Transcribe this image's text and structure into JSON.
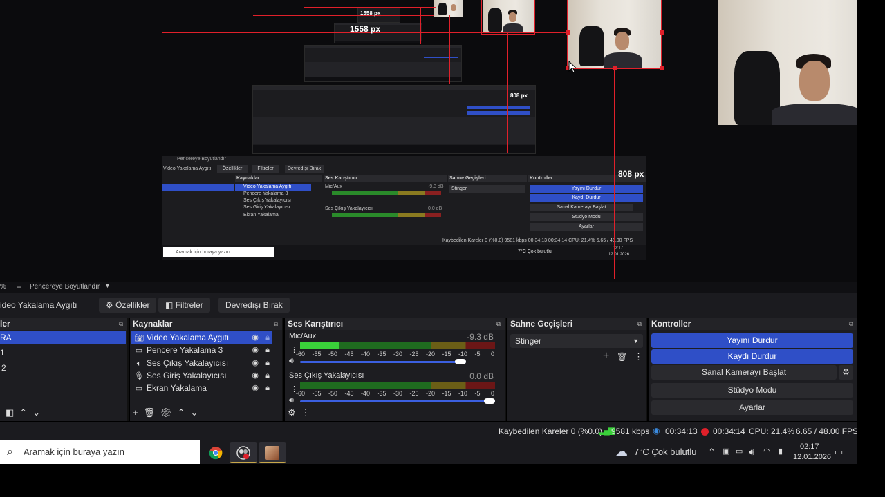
{
  "preview": {
    "labels": [
      "1558 px",
      "1558 px",
      "808 px",
      "808 px"
    ],
    "mid": {
      "toolbar": [
        "Video Yakalama Aygıtı",
        "Özellikler",
        "Filtreler",
        "Devredışı Bırak"
      ],
      "scene_bar": "Pencereye Boyutlandır",
      "heads": [
        "Kaynaklar",
        "Ses Karıştırıcı",
        "Sahne Geçişleri",
        "Kontroller"
      ],
      "sources": [
        "Video Yakalama Aygıtı",
        "Pencere Yakalama 3",
        "Ses Çıkış Yakalayıcısı",
        "Ses Giriş Yakalayıcısı",
        "Ekran Yakalama"
      ],
      "mixer": [
        "Mic/Aux",
        "-9.3 dB",
        "Ses Çıkış Yakalayıcısı",
        "0.0 dB"
      ],
      "transition": "Stinger",
      "controls": [
        "Yayını Durdur",
        "Kaydı Durdur",
        "Sanal Kamerayı Başlat",
        "Stüdyo Modu",
        "Ayarlar"
      ],
      "status": "Kaybedilen Kareler 0 (%0.0)  9581 kbps  00:34:13  00:34:14  CPU: 21.4%  6.65 / 48.00 FPS",
      "search": "Aramak için buraya yazın",
      "weather": "7°C  Çok bulutlu",
      "clock": "02:17",
      "date": "12.01.2026"
    }
  },
  "scene_bar": {
    "zoom": "%",
    "add": "+",
    "fit": "Pencereye Boyutlandır"
  },
  "toolbar": {
    "source_name": "ideo Yakalama Aygıtı",
    "properties": "Özellikler",
    "filters": "Filtreler",
    "disable": "Devredışı Bırak"
  },
  "scenes": {
    "title": "ler",
    "items": [
      "RA",
      "1",
      "2"
    ]
  },
  "sources": {
    "title": "Kaynaklar",
    "items": [
      {
        "label": "Video Yakalama Aygıtı",
        "icon": "camera-icon",
        "selected": true
      },
      {
        "label": "Pencere Yakalama 3",
        "icon": "window-icon",
        "selected": false
      },
      {
        "label": "Ses Çıkış Yakalayıcısı",
        "icon": "speaker-icon",
        "selected": false
      },
      {
        "label": "Ses Giriş Yakalayıcısı",
        "icon": "microphone-icon",
        "selected": false
      },
      {
        "label": "Ekran Yakalama",
        "icon": "monitor-icon",
        "selected": false
      }
    ]
  },
  "mixer": {
    "title": "Ses Karıştırıcı",
    "scale": [
      "-60",
      "-55",
      "-50",
      "-45",
      "-40",
      "-35",
      "-30",
      "-25",
      "-20",
      "-15",
      "-10",
      "-5",
      "0"
    ],
    "channels": [
      {
        "name": "Mic/Aux",
        "db": "-9.3 dB",
        "level": 0.2,
        "volume": 0.85
      },
      {
        "name": "Ses Çıkış Yakalayıcısı",
        "db": "0.0 dB",
        "level": 0.0,
        "volume": 1.0
      }
    ]
  },
  "transitions": {
    "title": "Sahne Geçişleri",
    "selected": "Stinger"
  },
  "controls": {
    "title": "Kontroller",
    "stop_stream": "Yayını Durdur",
    "stop_record": "Kaydı Durdur",
    "virtual_cam": "Sanal Kamerayı Başlat",
    "studio_mode": "Stüdyo Modu",
    "settings": "Ayarlar"
  },
  "status": {
    "dropped": "Kaybedilen Kareler 0 (%0.0)",
    "bitrate": "9581 kbps",
    "stream_time": "00:34:13",
    "record_time": "00:34:14",
    "cpu": "CPU: 21.4%",
    "fps": "6.65 / 48.00 FPS"
  },
  "taskbar": {
    "search_placeholder": "Aramak için buraya yazın",
    "weather": "7°C  Çok bulutlu",
    "time": "02:17",
    "date": "12.01.2026"
  },
  "colors": {
    "accent": "#2f4fc7",
    "guide_red": "#e0202a",
    "meter_green": "#3ad13a",
    "record_red": "#e0202a"
  }
}
